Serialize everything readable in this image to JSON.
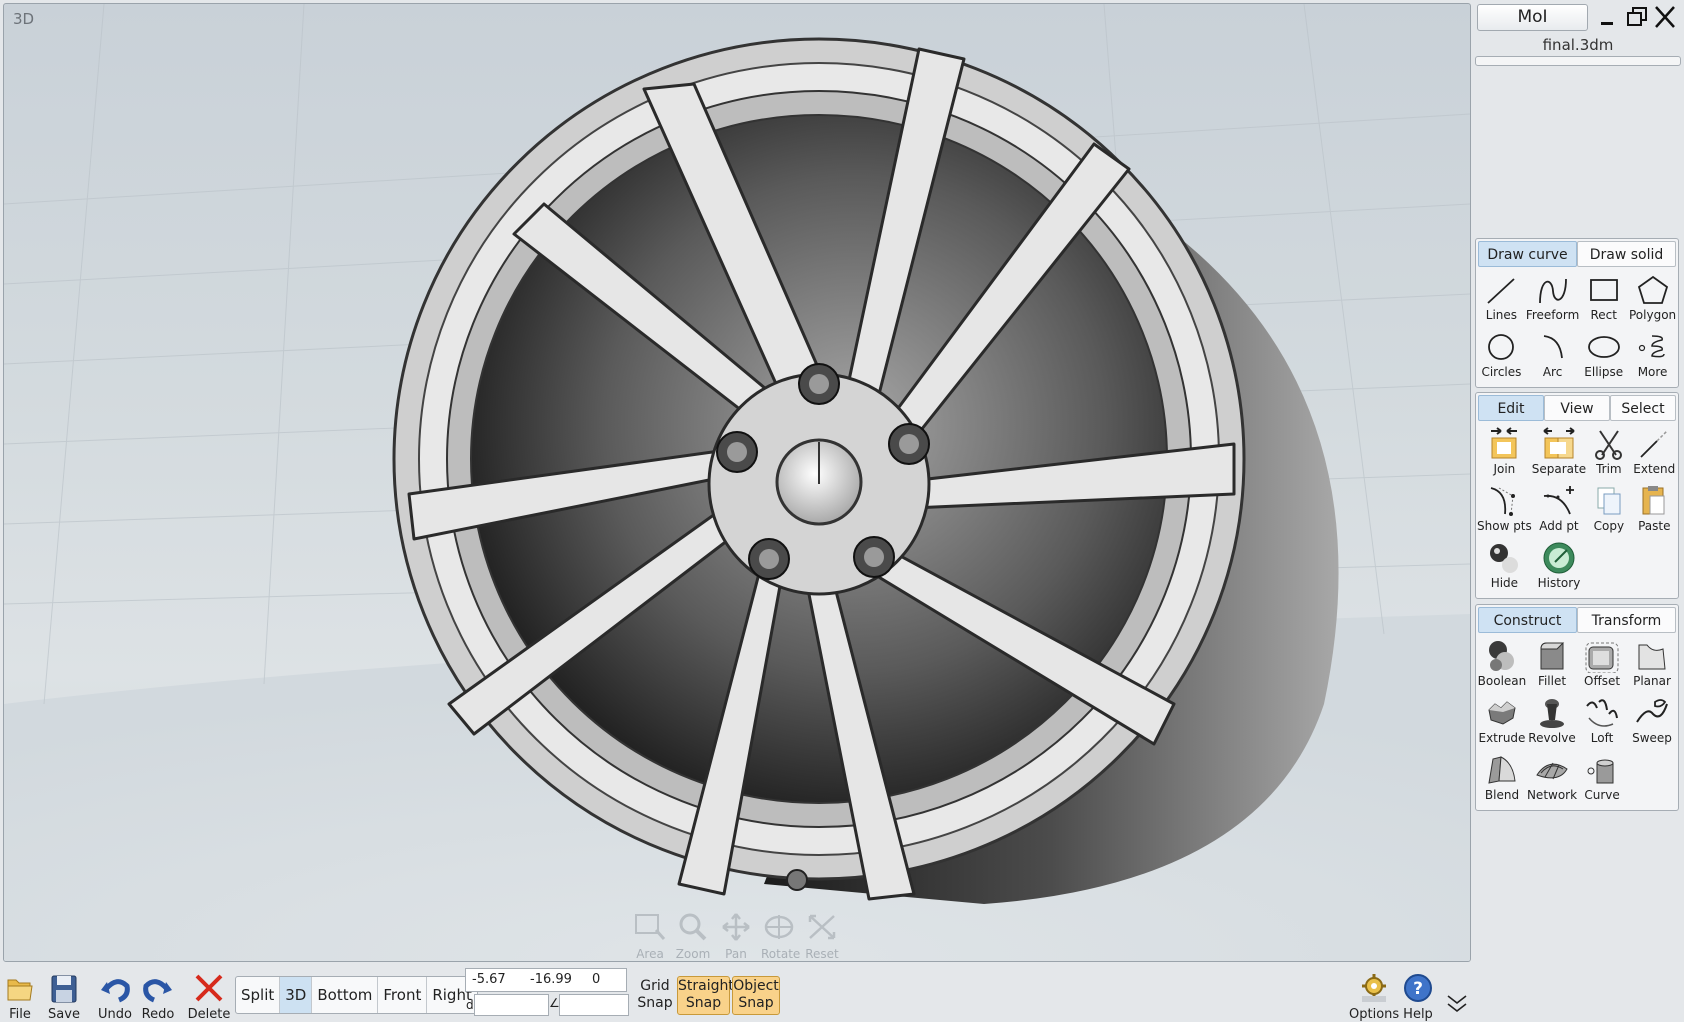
{
  "viewport": {
    "label": "3D",
    "nav": [
      {
        "label": "Area",
        "icon": "area-zoom-icon"
      },
      {
        "label": "Zoom",
        "icon": "zoom-icon"
      },
      {
        "label": "Pan",
        "icon": "pan-icon"
      },
      {
        "label": "Rotate",
        "icon": "rotate-icon"
      },
      {
        "label": "Reset",
        "icon": "reset-view-icon"
      }
    ]
  },
  "panel": {
    "app_title": "MoI",
    "file_name": "final.3dm",
    "draw": {
      "tabs": [
        "Draw curve",
        "Draw solid"
      ],
      "active_tab": 0,
      "tools": [
        {
          "label": "Lines",
          "icon": "line-icon"
        },
        {
          "label": "Freeform",
          "icon": "freeform-curve-icon"
        },
        {
          "label": "Rect",
          "icon": "rectangle-icon"
        },
        {
          "label": "Polygon",
          "icon": "polygon-icon"
        },
        {
          "label": "Circles",
          "icon": "circle-icon"
        },
        {
          "label": "Arc",
          "icon": "arc-icon"
        },
        {
          "label": "Ellipse",
          "icon": "ellipse-icon"
        },
        {
          "label": "More",
          "icon": "spiral-icon"
        }
      ]
    },
    "edit": {
      "tabs": [
        "Edit",
        "View",
        "Select"
      ],
      "active_tab": 0,
      "tools": [
        {
          "label": "Join",
          "icon": "join-icon"
        },
        {
          "label": "Separate",
          "icon": "separate-icon"
        },
        {
          "label": "Trim",
          "icon": "trim-scissors-icon"
        },
        {
          "label": "Extend",
          "icon": "extend-icon"
        },
        {
          "label": "Show pts",
          "icon": "show-points-icon"
        },
        {
          "label": "Add pt",
          "icon": "add-point-icon"
        },
        {
          "label": "Copy",
          "icon": "copy-icon"
        },
        {
          "label": "Paste",
          "icon": "paste-icon"
        },
        {
          "label": "Hide",
          "icon": "hide-icon"
        },
        {
          "label": "History",
          "icon": "history-icon"
        }
      ]
    },
    "construct": {
      "tabs": [
        "Construct",
        "Transform"
      ],
      "active_tab": 0,
      "tools": [
        {
          "label": "Boolean",
          "icon": "boolean-icon"
        },
        {
          "label": "Fillet",
          "icon": "fillet-icon"
        },
        {
          "label": "Offset",
          "icon": "offset-icon"
        },
        {
          "label": "Planar",
          "icon": "planar-icon"
        },
        {
          "label": "Extrude",
          "icon": "extrude-icon"
        },
        {
          "label": "Revolve",
          "icon": "revolve-icon"
        },
        {
          "label": "Loft",
          "icon": "loft-icon"
        },
        {
          "label": "Sweep",
          "icon": "sweep-icon"
        },
        {
          "label": "Blend",
          "icon": "blend-icon"
        },
        {
          "label": "Network",
          "icon": "network-icon"
        },
        {
          "label": "Curve",
          "icon": "curve-tool-icon"
        }
      ]
    }
  },
  "bottom": {
    "file": {
      "label": "File",
      "icon": "folder-icon"
    },
    "save": {
      "label": "Save",
      "icon": "floppy-disk-icon"
    },
    "undo": {
      "label": "Undo",
      "icon": "undo-arrow-icon"
    },
    "redo": {
      "label": "Redo",
      "icon": "redo-arrow-icon"
    },
    "delete": {
      "label": "Delete",
      "icon": "delete-x-icon"
    },
    "views": [
      "Split",
      "3D",
      "Bottom",
      "Front",
      "Right"
    ],
    "active_view": "3D",
    "coords": {
      "x": "-5.67",
      "y": "-16.99",
      "z": "0"
    },
    "distance_label": "d",
    "angle_label": "∠",
    "grid_snap": {
      "line1": "Grid",
      "line2": "Snap"
    },
    "straight_snap": {
      "line1": "Straight",
      "line2": "Snap"
    },
    "object_snap": {
      "line1": "Object",
      "line2": "Snap"
    },
    "options": {
      "label": "Options",
      "icon": "options-gear-icon"
    },
    "help": {
      "label": "Help",
      "icon": "help-question-icon"
    },
    "colors": {
      "snap_on": "#f9d28a",
      "active_tab": "#cfe2f3"
    }
  }
}
